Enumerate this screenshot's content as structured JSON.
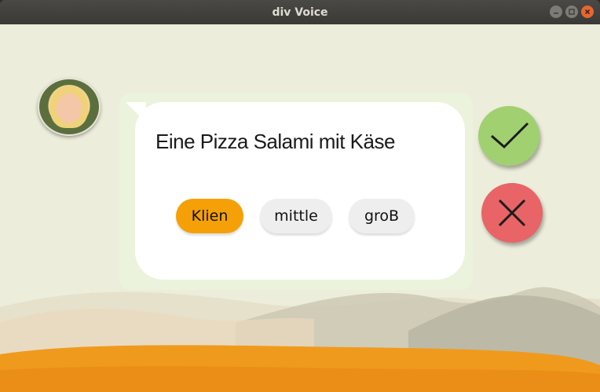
{
  "window": {
    "title": "div Voice"
  },
  "dialog": {
    "sentence": "Eine Pizza Salami mit Käse",
    "options": [
      {
        "label": "Klien",
        "selected": true
      },
      {
        "label": "mittle",
        "selected": false
      },
      {
        "label": "groB",
        "selected": false
      }
    ]
  },
  "actions": {
    "confirm_icon": "check-icon",
    "cancel_icon": "x-icon"
  },
  "colors": {
    "accent": "#f5a007",
    "confirm": "#a0d070",
    "cancel": "#e86467",
    "background": "#ecedda",
    "orange_wave": "#f09a1d"
  }
}
